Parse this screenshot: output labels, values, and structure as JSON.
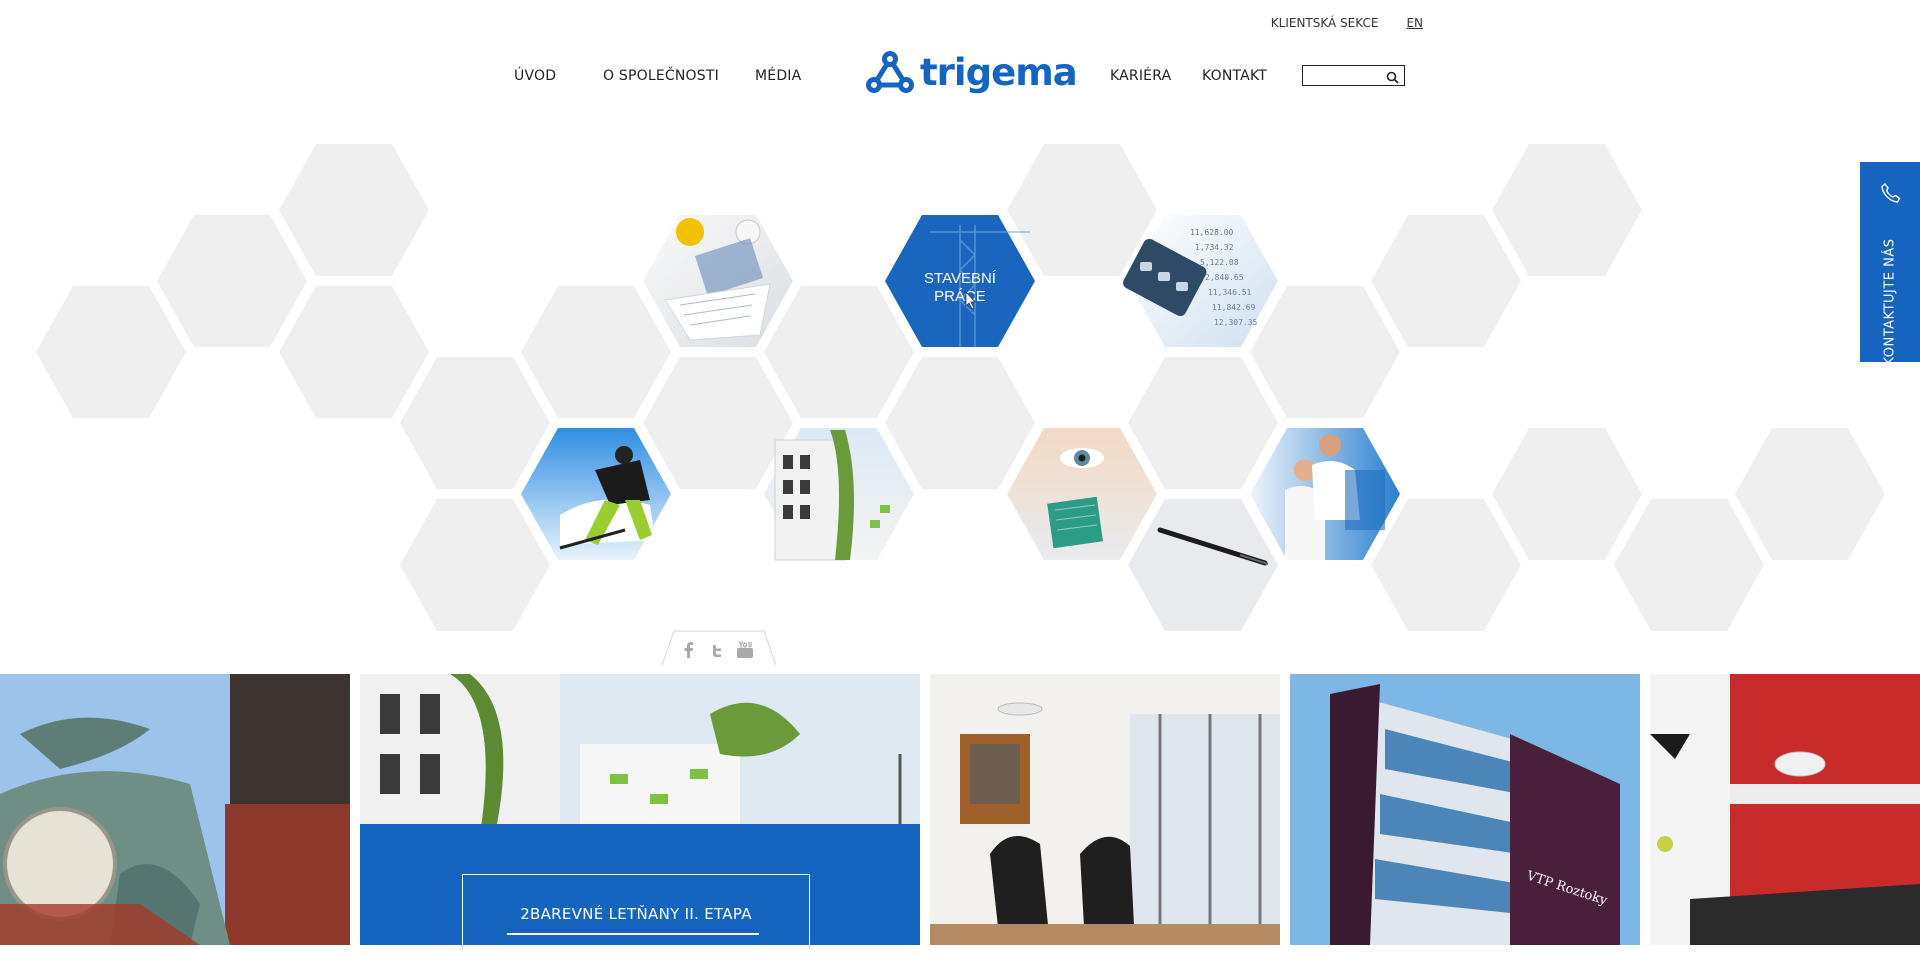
{
  "header": {
    "top_links": {
      "client": "KLIENTSKÁ SEKCE",
      "lang": "EN"
    },
    "nav_left": [
      "ÚVOD",
      "O SPOLEČNOSTI",
      "MÉDIA"
    ],
    "nav_right": [
      "KARIÉRA",
      "KONTAKT"
    ],
    "logo_text": "trigema",
    "search": {
      "value": "",
      "placeholder": ""
    }
  },
  "hero": {
    "active_label_line1": "STAVEBNÍ",
    "active_label_line2": "PRÁCE",
    "colors": {
      "brand": "#1565c0",
      "hex_gray": "#efefef"
    }
  },
  "contact_tab": {
    "label": "KONTAKTUJTE NÁS",
    "icon": "phone-icon"
  },
  "social": [
    "facebook-icon",
    "twitter-icon",
    "youtube-icon"
  ],
  "featured": {
    "title": "2BAREVNÉ LETŇANY II. ETAPA"
  }
}
